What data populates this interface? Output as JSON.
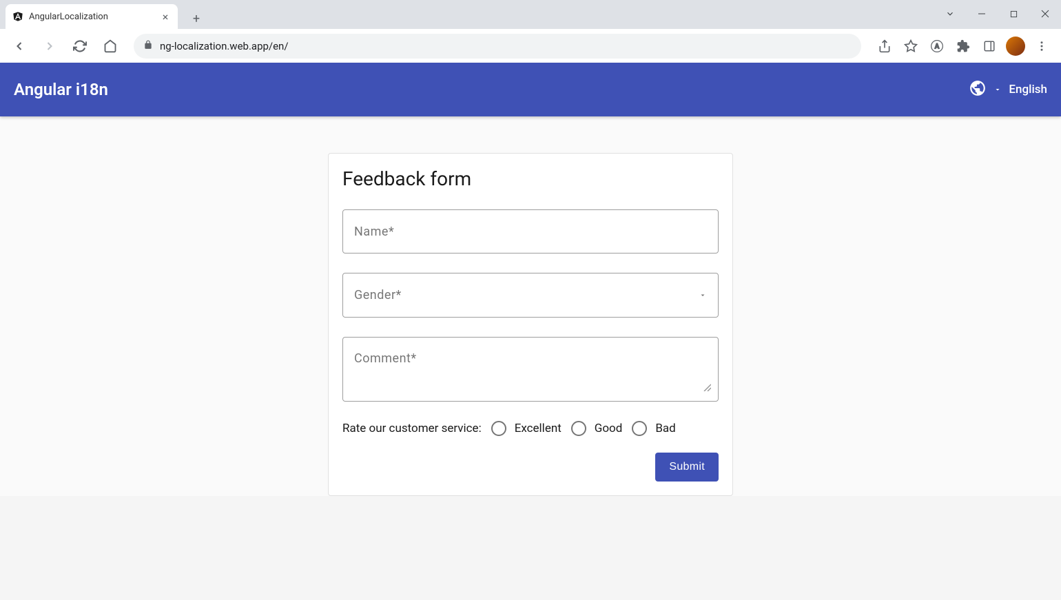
{
  "browser": {
    "tab_title": "AngularLocalization",
    "url": "ng-localization.web.app/en/"
  },
  "header": {
    "title": "Angular i18n",
    "language": "English"
  },
  "form": {
    "title": "Feedback form",
    "name_label": "Name*",
    "gender_label": "Gender*",
    "comment_label": "Comment*",
    "rate_label": "Rate our customer service:",
    "options": {
      "excellent": "Excellent",
      "good": "Good",
      "bad": "Bad"
    },
    "submit_label": "Submit"
  }
}
